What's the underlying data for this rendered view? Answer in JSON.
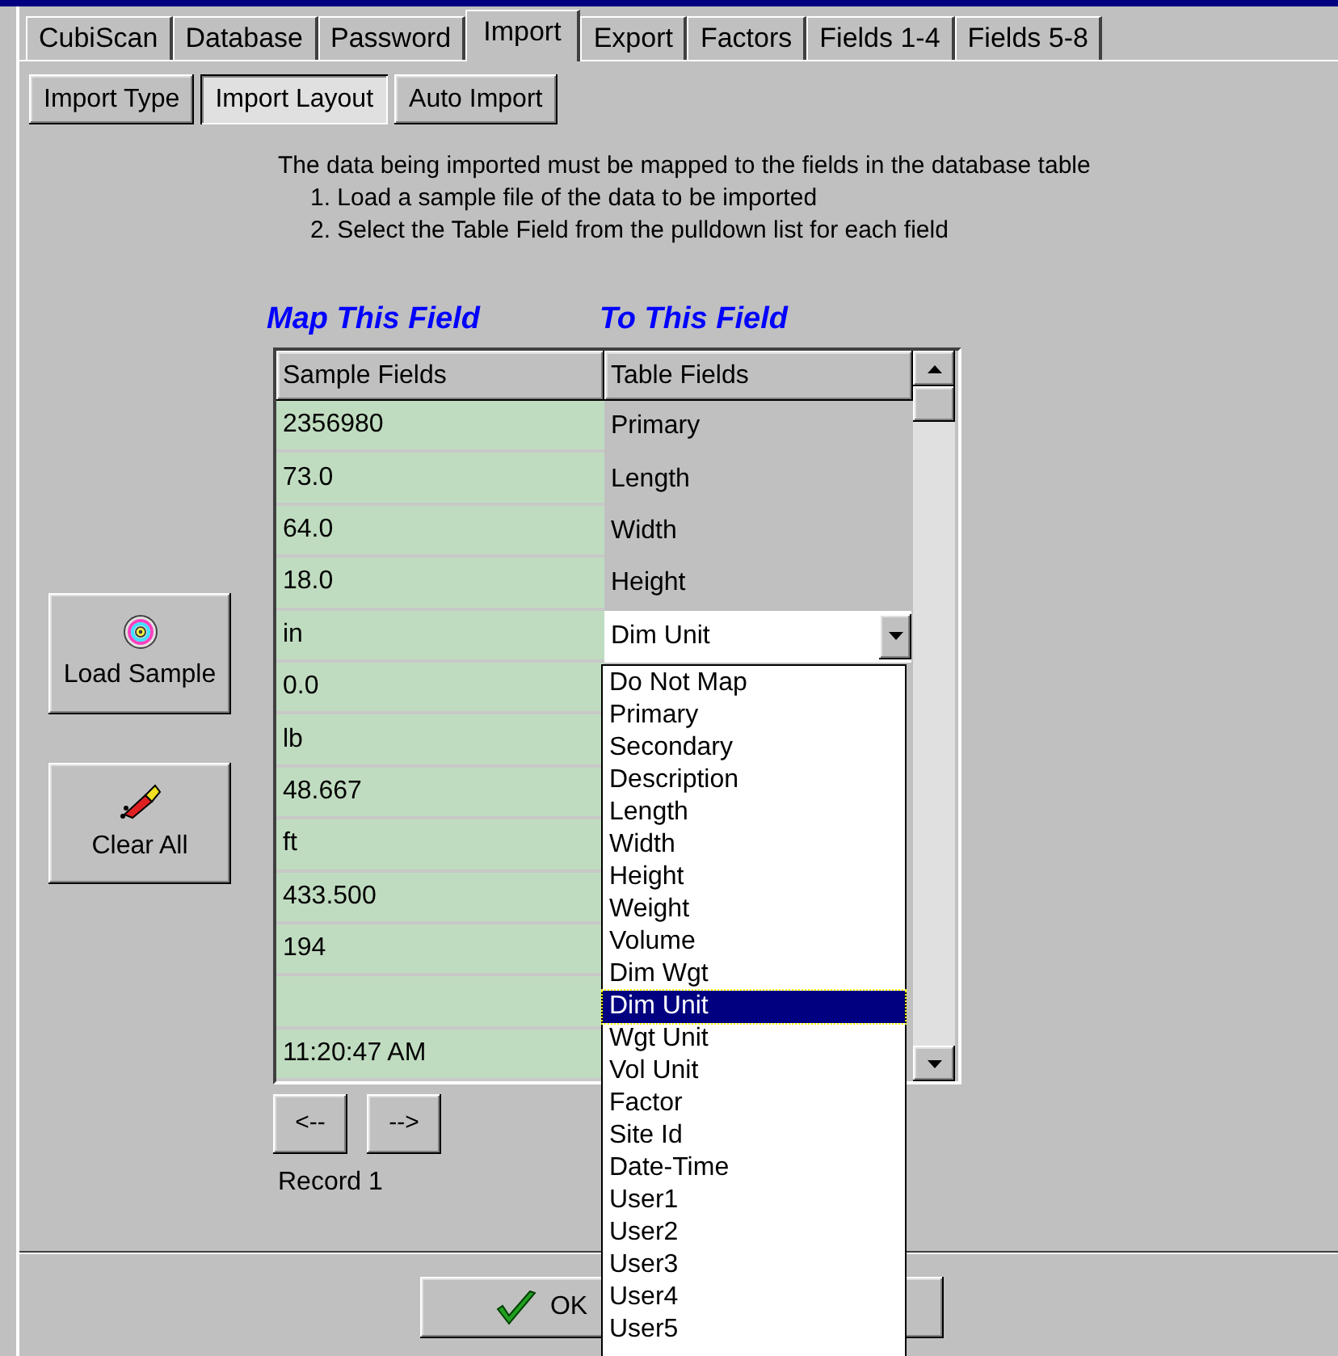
{
  "tabs": [
    {
      "label": "CubiScan",
      "selected": false
    },
    {
      "label": "Database",
      "selected": false
    },
    {
      "label": "Password",
      "selected": false
    },
    {
      "label": "Import",
      "selected": true
    },
    {
      "label": "Export",
      "selected": false
    },
    {
      "label": "Factors",
      "selected": false
    },
    {
      "label": "Fields 1-4",
      "selected": false
    },
    {
      "label": "Fields 5-8",
      "selected": false
    }
  ],
  "subtabs": [
    {
      "label": "Import Type",
      "selected": false
    },
    {
      "label": "Import Layout",
      "selected": true
    },
    {
      "label": "Auto Import",
      "selected": false
    }
  ],
  "instructions": [
    "The data being imported must be mapped to the fields in the database table",
    "1.  Load a sample file of the data to be imported",
    "2.  Select the Table Field from the pulldown list for each field"
  ],
  "mapping_headings": [
    "Map This Field",
    "To This Field"
  ],
  "grid": {
    "columns": [
      "Sample Fields",
      "Table Fields"
    ],
    "rows": [
      {
        "sample": "2356980",
        "table_field": "Primary"
      },
      {
        "sample": "73.0",
        "table_field": "Length"
      },
      {
        "sample": "64.0",
        "table_field": "Width"
      },
      {
        "sample": "18.0",
        "table_field": "Height"
      },
      {
        "sample": "in",
        "editor": {
          "value": "Dim Unit"
        }
      },
      {
        "sample": "0.0"
      },
      {
        "sample": "lb"
      },
      {
        "sample": "48.667"
      },
      {
        "sample": "ft"
      },
      {
        "sample": "433.500"
      },
      {
        "sample": "194"
      },
      {
        "sample": ""
      },
      {
        "sample": "11:20:47 AM"
      }
    ]
  },
  "dropdown": [
    {
      "label": "Do Not Map",
      "selected": false
    },
    {
      "label": "Primary",
      "selected": false
    },
    {
      "label": "Secondary",
      "selected": false
    },
    {
      "label": "Description",
      "selected": false
    },
    {
      "label": "Length",
      "selected": false
    },
    {
      "label": "Width",
      "selected": false
    },
    {
      "label": "Height",
      "selected": false
    },
    {
      "label": "Weight",
      "selected": false
    },
    {
      "label": "Volume",
      "selected": false
    },
    {
      "label": "Dim Wgt",
      "selected": false
    },
    {
      "label": "Dim Unit",
      "selected": true
    },
    {
      "label": "Wgt Unit",
      "selected": false
    },
    {
      "label": "Vol Unit",
      "selected": false
    },
    {
      "label": "Factor",
      "selected": false
    },
    {
      "label": "Site Id",
      "selected": false
    },
    {
      "label": "Date-Time",
      "selected": false
    },
    {
      "label": "User1",
      "selected": false
    },
    {
      "label": "User2",
      "selected": false
    },
    {
      "label": "User3",
      "selected": false
    },
    {
      "label": "User4",
      "selected": false
    },
    {
      "label": "User5",
      "selected": false
    }
  ],
  "side_buttons": [
    {
      "label": "Load Sample",
      "kind": "disc"
    },
    {
      "label": "Clear All",
      "kind": "eraser"
    }
  ],
  "navigation": {
    "previous": "<--",
    "next": "-->",
    "record": "Record 1"
  },
  "footer_buttons": [
    {
      "label": "OK",
      "kind": "check"
    }
  ]
}
